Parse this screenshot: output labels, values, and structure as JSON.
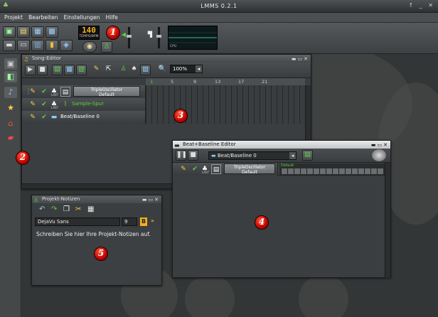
{
  "app": {
    "title": "LMMS 0.2.1",
    "window_controls": "↑ _ ✕"
  },
  "menu": {
    "items": [
      "Projekt",
      "Bearbeiten",
      "Einstellungen",
      "Hilfe"
    ]
  },
  "toolbar": {
    "tempo_value": "140",
    "tempo_label": "TEMPO/BPM",
    "cpu_label": "CPU"
  },
  "badges": [
    "1",
    "2",
    "3",
    "4",
    "5"
  ],
  "song_editor": {
    "title": "Song-Editor",
    "zoom": "100%",
    "ruler": [
      "1",
      "5",
      "9",
      "13",
      "17",
      "21"
    ],
    "tracks": [
      {
        "type": "instrument",
        "label_line1": "TripleOscillator",
        "label_line2": "Default",
        "act": "LAST"
      },
      {
        "type": "sample",
        "name": "Sample-Spur",
        "act": "LAST"
      },
      {
        "type": "beat",
        "name": "Beat/Baseline 0"
      }
    ]
  },
  "beat_editor": {
    "title": "Beat+Baseline Editor",
    "selector": "Beat/Baseline 0",
    "track": {
      "label_line1": "TripleOscillator",
      "label_line2": "Default",
      "act": "LAST",
      "pattern_label": "Default"
    }
  },
  "notes": {
    "title": "Projekt-Notizen",
    "font": "DejaVu Sans",
    "size": "9",
    "text": "Schreiben Sie hier Ihre Projekt-Notizen auf."
  },
  "colors": {
    "accent_green": "#5cd040",
    "badge_red": "#d01010",
    "lcd_amber": "#f0b020"
  }
}
